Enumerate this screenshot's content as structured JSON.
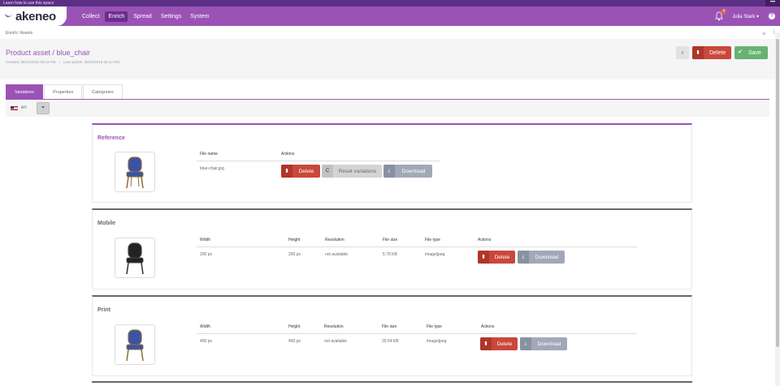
{
  "learn_bar": {
    "text": "Learn how to use this space",
    "more": "•••"
  },
  "nav": {
    "logo_text": "akeneo",
    "items": [
      {
        "label": "Collect",
        "active": false
      },
      {
        "label": "Enrich",
        "active": true
      },
      {
        "label": "Spread",
        "active": false
      },
      {
        "label": "Settings",
        "active": false
      },
      {
        "label": "System",
        "active": false
      }
    ],
    "notification_count": "4",
    "user_name": "Julia Stark ▾",
    "help": "?"
  },
  "breadcrumb": "Enrich / Assets",
  "header": {
    "title": "Product asset / blue_chair",
    "created": "Created: 06/10/2016 05:12 PM",
    "updated": "Last update: 06/10/2016 05:12 PM",
    "back_icon": "‹",
    "delete_label": "Delete",
    "save_label": "Save"
  },
  "tabs": [
    {
      "label": "Variations",
      "active": true
    },
    {
      "label": "Properties",
      "active": false
    },
    {
      "label": "Categories",
      "active": false
    }
  ],
  "locale": {
    "code": "en",
    "dropdown_icon": "▾"
  },
  "reference": {
    "title": "Reference",
    "col_file_name": "File name",
    "col_actions": "Actions",
    "file_name": "blue-chair.jpg",
    "delete_label": "Delete",
    "reset_label": "Reset variations",
    "download_label": "Download",
    "chair_color": "#3a53a5"
  },
  "variation_columns": {
    "width": "Width",
    "height": "Height",
    "resolution": "Resolution",
    "file_size": "File size",
    "file_type": "File type",
    "actions": "Actions"
  },
  "variations": [
    {
      "title": "Mobile",
      "width": "200 px",
      "height": "200 px",
      "resolution": "not available",
      "file_size": "5.78 KB",
      "file_type": "image/jpeg",
      "delete_label": "Delete",
      "download_label": "Download",
      "chair_color": "#222222"
    },
    {
      "title": "Print",
      "width": "400 px",
      "height": "400 px",
      "resolution": "not available",
      "file_size": "20.54 KB",
      "file_type": "image/jpeg",
      "delete_label": "Delete",
      "download_label": "Download",
      "chair_color": "#3a53a5"
    }
  ],
  "colors": {
    "brand_purple": "#9a53b5",
    "danger": "#c9473b",
    "success": "#67b373"
  }
}
